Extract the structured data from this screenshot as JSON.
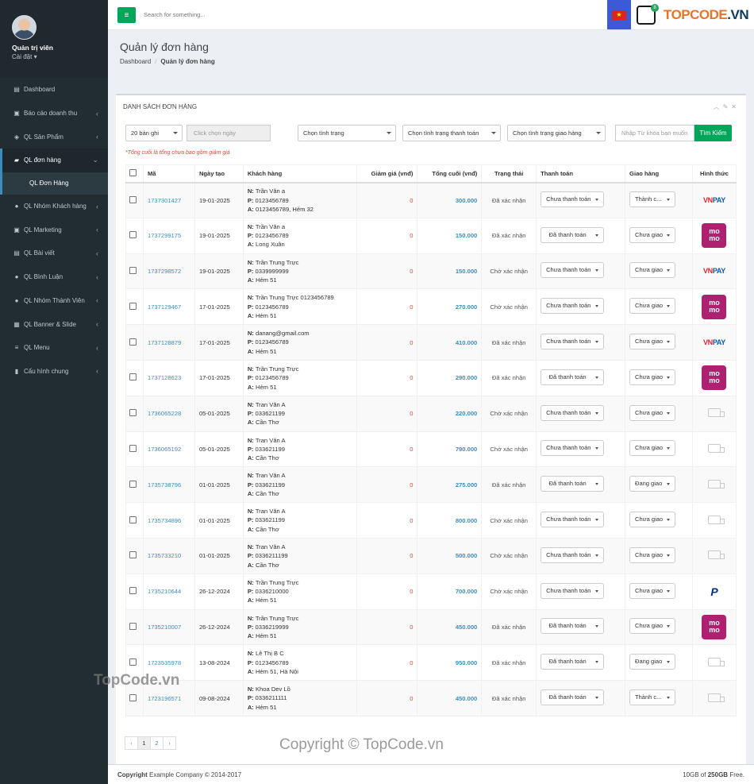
{
  "user": {
    "name": "Quản trị viên",
    "settings": "Cài đặt"
  },
  "menu": [
    {
      "label": "Dashboard",
      "icon": "dashboard-icon"
    },
    {
      "label": "Báo cáo doanh thu",
      "icon": "report-icon"
    },
    {
      "label": "QL Sản Phẩm",
      "icon": "product-icon"
    },
    {
      "label": "QL đơn hàng",
      "icon": "bag-icon"
    },
    {
      "label": "QL Nhóm Khách hàng",
      "icon": "user-icon"
    },
    {
      "label": "QL Marketing",
      "icon": "marketing-icon"
    },
    {
      "label": "QL Bài viết",
      "icon": "post-icon"
    },
    {
      "label": "QL Bình Luận",
      "icon": "comment-icon"
    },
    {
      "label": "QL Nhóm Thành Viên",
      "icon": "member-icon"
    },
    {
      "label": "QL Banner & Slide",
      "icon": "image-icon"
    },
    {
      "label": "QL Menu",
      "icon": "menu-icon"
    },
    {
      "label": "Cấu hình chung",
      "icon": "config-icon"
    }
  ],
  "submenu": {
    "label": "QL Đơn Hàng"
  },
  "topbar": {
    "search_placeholder": "Search for something...",
    "logo_text": "TOPCODE",
    "logo_suffix": ".VN",
    "logo_badge": "8"
  },
  "header": {
    "title": "Quản lý đơn hàng",
    "crumb_home": "Dashboard",
    "crumb_current": "Quản lý đơn hàng"
  },
  "panel": {
    "title": "DANH SÁCH ĐƠN HÀNG",
    "page_size": "20 bản ghi",
    "date_placeholder": "Click chọn ngày",
    "status_filter": "Chọn tình trạng",
    "payment_filter": "Chọn tình trạng thanh toán",
    "shipping_filter": "Chọn tình trạng giao hàng",
    "keyword_placeholder": "Nhập Từ khóa bạn muốn",
    "search_button": "Tìm Kiếm",
    "note": "*Tổng cuối là tổng chưa bao gồm giảm giá"
  },
  "columns": {
    "code": "Mã",
    "date": "Ngày tạo",
    "customer": "Khách hàng",
    "discount": "Giảm giá (vnđ)",
    "total": "Tổng cuối (vnđ)",
    "status": "Trạng thái",
    "payment": "Thanh toán",
    "shipping": "Giao hàng",
    "method": "Hình thức"
  },
  "orders": [
    {
      "code": "1737301427",
      "date": "19-01-2025",
      "name": "Trần Văn a",
      "phone": "0123456789",
      "address": "0123456789, Hẻm 32",
      "discount": "0",
      "total": "300.000",
      "status": "Đã xác nhận",
      "payment": "Chưa thanh toán",
      "shipping": "Thành c...",
      "method": "vnpay"
    },
    {
      "code": "1737299175",
      "date": "19-01-2025",
      "name": "Trần Văn a",
      "phone": "0123456789",
      "address": "Long Xuân",
      "discount": "0",
      "total": "150.000",
      "status": "Đã xác nhận",
      "payment": "Đã thanh toán",
      "shipping": "Chưa giao",
      "method": "momo"
    },
    {
      "code": "1737298572",
      "date": "19-01-2025",
      "name": "Trần Trung Trực",
      "phone": "0339999999",
      "address": "Hẻm 51",
      "discount": "0",
      "total": "150.000",
      "status": "Chờ xác nhận",
      "payment": "Chưa thanh toán",
      "shipping": "Chưa giao",
      "method": "vnpay"
    },
    {
      "code": "1737129467",
      "date": "17-01-2025",
      "name": "Trần Trung Trực 0123456789",
      "phone": "0123456789",
      "address": "Hẻm 51",
      "discount": "0",
      "total": "270.000",
      "status": "Chờ xác nhận",
      "payment": "Chưa thanh toán",
      "shipping": "Chưa giao",
      "method": "momo"
    },
    {
      "code": "1737128879",
      "date": "17-01-2025",
      "name": "danang@gmail.com",
      "phone": "0123456789",
      "address": "Hẻm 51",
      "discount": "0",
      "total": "410.000",
      "status": "Đã xác nhận",
      "payment": "Chưa thanh toán",
      "shipping": "Chưa giao",
      "method": "vnpay"
    },
    {
      "code": "1737128623",
      "date": "17-01-2025",
      "name": "Trần Trung Trực",
      "phone": "0123456789",
      "address": "Hẻm 51",
      "discount": "0",
      "total": "290.000",
      "status": "Đã xác nhận",
      "payment": "Đã thanh toán",
      "shipping": "Chưa giao",
      "method": "momo"
    },
    {
      "code": "1736065228",
      "date": "05-01-2025",
      "name": "Tran Văn A",
      "phone": "033621199",
      "address": "Cần Thơ",
      "discount": "0",
      "total": "220.000",
      "status": "Chờ xác nhận",
      "payment": "Chưa thanh toán",
      "shipping": "Chưa giao",
      "method": "cod"
    },
    {
      "code": "1736065192",
      "date": "05-01-2025",
      "name": "Tran Văn A",
      "phone": "033621199",
      "address": "Cần Thơ",
      "discount": "0",
      "total": "790.000",
      "status": "Chờ xác nhận",
      "payment": "Chưa thanh toán",
      "shipping": "Chưa giao",
      "method": "cod"
    },
    {
      "code": "1735738796",
      "date": "01-01-2025",
      "name": "Tran Văn A",
      "phone": "033621199",
      "address": "Cần Thơ",
      "discount": "0",
      "total": "275.000",
      "status": "Đã xác nhận",
      "payment": "Đã thanh toán",
      "shipping": "Đang giao",
      "method": "cod"
    },
    {
      "code": "1735734896",
      "date": "01-01-2025",
      "name": "Tran Văn A",
      "phone": "033621199",
      "address": "Cần Thơ",
      "discount": "0",
      "total": "800.000",
      "status": "Chờ xác nhận",
      "payment": "Chưa thanh toán",
      "shipping": "Chưa giao",
      "method": "cod"
    },
    {
      "code": "1735733210",
      "date": "01-01-2025",
      "name": "Tran Văn A",
      "phone": "0336211199",
      "address": "Cần Thơ",
      "discount": "0",
      "total": "500.000",
      "status": "Chờ xác nhận",
      "payment": "Chưa thanh toán",
      "shipping": "Chưa giao",
      "method": "cod"
    },
    {
      "code": "1735210644",
      "date": "26-12-2024",
      "name": "Trần Trung Trực",
      "phone": "0336210000",
      "address": "Hẻm 51",
      "discount": "0",
      "total": "700.000",
      "status": "Chờ xác nhận",
      "payment": "Chưa thanh toán",
      "shipping": "Chưa giao",
      "method": "paypal"
    },
    {
      "code": "1735210007",
      "date": "26-12-2024",
      "name": "Trần Trung Trực",
      "phone": "0336219999",
      "address": "Hẻm 51",
      "discount": "0",
      "total": "450.000",
      "status": "Đã xác nhận",
      "payment": "Đã thanh toán",
      "shipping": "Chưa giao",
      "method": "momo"
    },
    {
      "code": "1723535978",
      "date": "13-08-2024",
      "name": "Lê Thị B C",
      "phone": "0123456789",
      "address": "Hẻm 51, Hà Nội",
      "discount": "0",
      "total": "950.000",
      "status": "Đã xác nhận",
      "payment": "Đã thanh toán",
      "shipping": "Đang giao",
      "method": "cod"
    },
    {
      "code": "1723196571",
      "date": "09-08-2024",
      "name": "Khoa Dev Lồ",
      "phone": "0336211111",
      "address": "Hẻm 51",
      "discount": "0",
      "total": "450.000",
      "status": "Đã xác nhận",
      "payment": "Đã thanh toán",
      "shipping": "Thành c...",
      "method": "cod"
    }
  ],
  "labels": {
    "n": "N:",
    "p": "P:",
    "a": "A:",
    "vn": "VN",
    "pay": "PAY",
    "momo1": "mo",
    "momo2": "mo",
    "paypal": "P"
  },
  "pagination": {
    "prev": "‹",
    "pages": [
      "1",
      "2"
    ],
    "next": "›"
  },
  "footer": {
    "copyright_bold": "Copyright",
    "copyright_text": " Example Company © 2014-2017",
    "usage": "10GB of ",
    "usage_bold": "250GB",
    "usage_end": " Free."
  },
  "watermark": {
    "small": "TopCode.vn",
    "copyright": "Copyright © TopCode.vn"
  }
}
